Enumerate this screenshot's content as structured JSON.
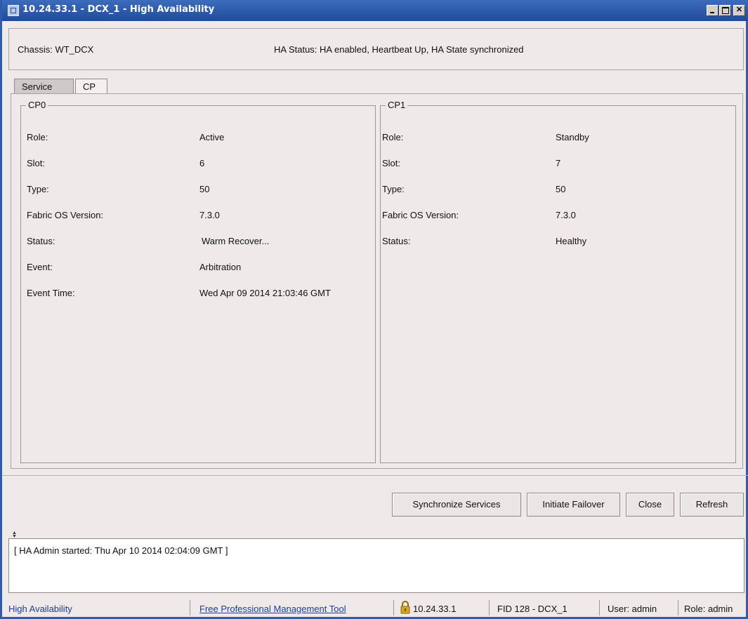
{
  "window": {
    "title": "10.24.33.1 - DCX_1 - High Availability"
  },
  "header": {
    "chassis": "Chassis:  WT_DCX",
    "ha_status": "HA Status:  HA enabled, Heartbeat Up, HA State synchronized"
  },
  "tabs": [
    {
      "label": "Service",
      "selected": true
    },
    {
      "label": "CP",
      "selected": false
    }
  ],
  "cp0": {
    "title": "CP0",
    "rows": [
      {
        "label": "Role:",
        "value": "Active"
      },
      {
        "label": "Slot:",
        "value": "6"
      },
      {
        "label": "Type:",
        "value": "50"
      },
      {
        "label": "Fabric OS Version:",
        "value": "7.3.0"
      },
      {
        "label": "Status:",
        "value": "Warm Recover..."
      },
      {
        "label": "Event:",
        "value": "Arbitration"
      },
      {
        "label": "Event Time:",
        "value": "Wed Apr 09 2014 21:03:46 GMT"
      }
    ]
  },
  "cp1": {
    "title": "CP1",
    "rows": [
      {
        "label": "Role:",
        "value": "Standby"
      },
      {
        "label": "Slot:",
        "value": "7"
      },
      {
        "label": "Type:",
        "value": "50"
      },
      {
        "label": "Fabric OS Version:",
        "value": "7.3.0"
      },
      {
        "label": "Status:",
        "value": "Healthy"
      }
    ]
  },
  "buttons": {
    "synchronize": "Synchronize Services",
    "failover": "Initiate Failover",
    "close": "Close",
    "refresh": "Refresh"
  },
  "log": {
    "line": "[ HA Admin started: Thu Apr 10 2014 02:04:09 GMT ]"
  },
  "status_bar": {
    "module": "High Availability",
    "link": "Free Professional Management Tool",
    "ip": "10.24.33.1",
    "fid": "FID 128 - DCX_1",
    "user": "User: admin",
    "role": "Role: admin"
  },
  "colors": {
    "titlebar": "#2a57a6",
    "link": "#1b3da8",
    "lock": "#d9a521"
  },
  "icons": {
    "window": "app-window-icon",
    "lock": "lock-icon"
  }
}
